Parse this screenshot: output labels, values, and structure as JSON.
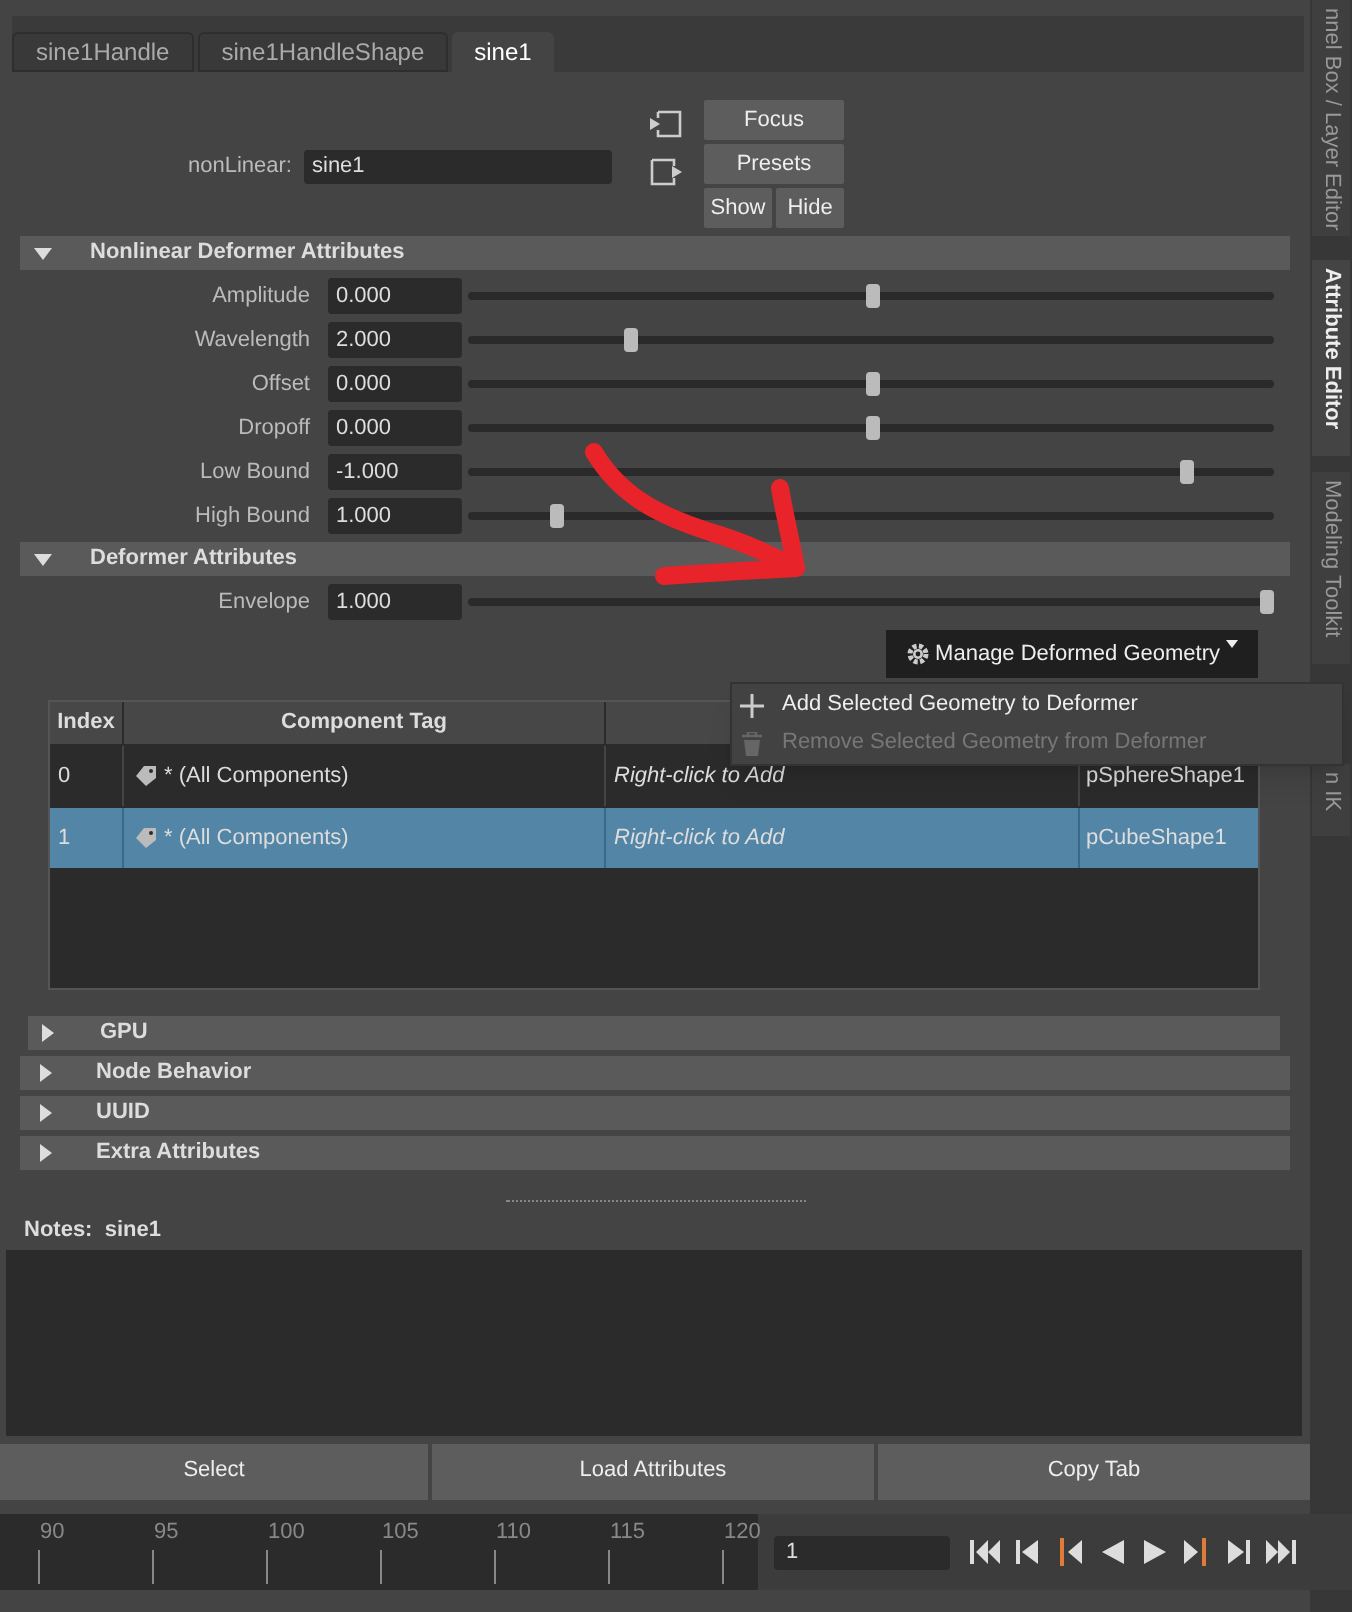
{
  "tabs": [
    {
      "label": "sine1Handle",
      "selected": false
    },
    {
      "label": "sine1HandleShape",
      "selected": false
    },
    {
      "label": "sine1",
      "selected": true
    }
  ],
  "node": {
    "label": "nonLinear:",
    "value": "sine1"
  },
  "node_buttons": {
    "focus": "Focus",
    "presets": "Presets",
    "show": "Show",
    "hide": "Hide"
  },
  "sections": [
    {
      "title": "Nonlinear Deformer Attributes",
      "expanded": true,
      "attributes": [
        {
          "label": "Amplitude",
          "value": "0.000",
          "level": 0.5
        },
        {
          "label": "Wavelength",
          "value": "2.000",
          "level": 0.2
        },
        {
          "label": "Offset",
          "value": "0.000",
          "level": 0.5
        },
        {
          "label": "Dropoff",
          "value": "0.000",
          "level": 0.5
        },
        {
          "label": "Low Bound",
          "value": "-1.000",
          "level": 0.89
        },
        {
          "label": "High Bound",
          "value": "1.000",
          "level": 0.11
        }
      ]
    },
    {
      "title": "Deformer Attributes",
      "expanded": true,
      "attributes": [
        {
          "label": "Envelope",
          "value": "1.000",
          "level": 0.99
        }
      ]
    }
  ],
  "manage_button": "Manage Deformed Geometry",
  "table": {
    "columns": [
      "Index",
      "Component Tag"
    ],
    "rows": [
      {
        "index": "0",
        "tag": "* (All Components)",
        "column_3": "Right-click to Add",
        "column_4": "pSphereShape1",
        "selected": false
      },
      {
        "index": "1",
        "tag": "* (All Components)",
        "column_3": "Right-click to Add",
        "column_4": "pCubeShape1",
        "selected": true
      }
    ]
  },
  "menu": [
    {
      "label": "Add Selected Geometry to Deformer",
      "kind": "add",
      "disabled": false
    },
    {
      "label": "Remove Selected Geometry from Deformer",
      "kind": "remove",
      "disabled": true
    }
  ],
  "collapsed_sections": [
    {
      "title": "GPU",
      "expanded": false
    },
    {
      "title": "Node Behavior",
      "expanded": false
    },
    {
      "title": "UUID",
      "expanded": false
    },
    {
      "title": "Extra Attributes",
      "expanded": false
    }
  ],
  "notes": {
    "label": "Notes:  sine1"
  },
  "bottom_buttons": [
    "Select",
    "Load Attributes",
    "Copy Tab"
  ],
  "side_tabs": [
    {
      "label": "nnel Box / Layer Editor",
      "selected": false
    },
    {
      "label": "Attribute Editor",
      "selected": true
    },
    {
      "label": "Modeling Toolkit",
      "selected": false
    },
    {
      "label": "n IK",
      "selected": false
    }
  ],
  "timeline": {
    "ticks": [
      "90",
      "95",
      "100",
      "105",
      "110",
      "115",
      "120"
    ],
    "current_frame": "1"
  }
}
